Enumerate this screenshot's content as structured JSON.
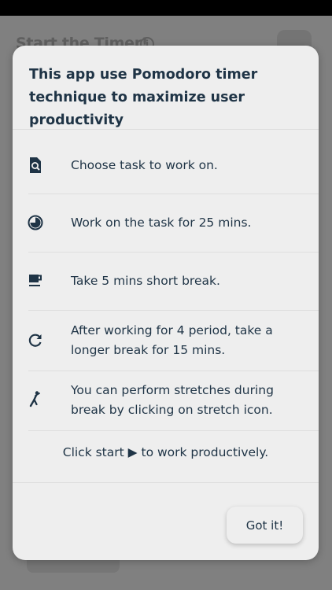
{
  "background": {
    "title": "Start the Timer!",
    "info_glyph": "i"
  },
  "dialog": {
    "title": "This app use Pomodoro timer technique to maximize user productivity",
    "items": [
      {
        "icon": "search-document-icon",
        "text": "Choose task to work on."
      },
      {
        "icon": "timer-icon",
        "text": "Work on the task for 25 mins."
      },
      {
        "icon": "coffee-cup-icon",
        "text": "Take 5 mins short break."
      },
      {
        "icon": "refresh-icon",
        "text": "After working for 4 period, take a longer break for 15 mins."
      },
      {
        "icon": "stretch-icon",
        "text": "You can perform stretches during break by clicking on stretch icon."
      }
    ],
    "closing": "Click start ▶ to work productively.",
    "button_label": "Got it!"
  },
  "colors": {
    "text": "#1f3446",
    "dialog_bg": "#eeeeee",
    "overlay": "#808080"
  }
}
